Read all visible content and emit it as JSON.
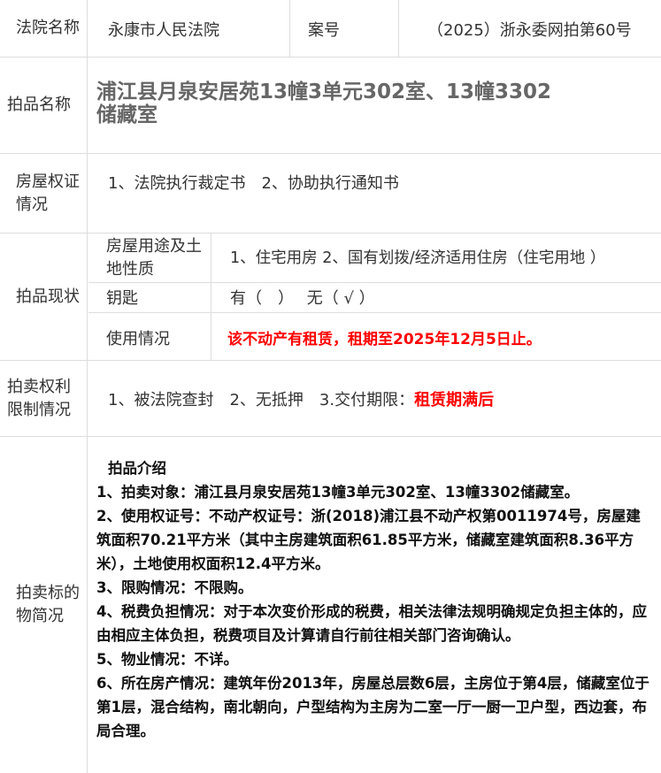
{
  "court": {
    "label": "法院名称",
    "value": "永康市人民法院",
    "case_label": "案号",
    "case_value": "（2025）浙永委网拍第60号"
  },
  "item_name": {
    "label": "拍品名称",
    "value": "浦江县月泉安居苑13幢3单元302室、13幢3302储藏室"
  },
  "certificate": {
    "label": "房屋权证情况",
    "value": "1、法院执行裁定书　2、协助执行通知书"
  },
  "status": {
    "label": "拍品现状",
    "usage_label": "房屋用途及土地性质",
    "usage_value": "1、住宅用房 2、国有划拨/经济适用住房（住宅用地 ）",
    "key_label": "钥匙",
    "key_value": "有（　）　 无（ √ ）",
    "use_label": "使用情况",
    "use_value": "该不动产有租赁，租期至2025年12月5日止。"
  },
  "restriction": {
    "label": "拍卖权利限制情况",
    "value_prefix": "1、被法院查封　2、无抵押　3.交付期限：",
    "value_highlight": "租赁期满后"
  },
  "description": {
    "label": "拍卖标的物简况",
    "heading": "拍品介绍",
    "lines": [
      "1、拍卖对象：浦江县月泉安居苑13幢3单元302室、13幢3302储藏室。",
      "2、使用权证号：不动产权证号：浙(2018)浦江县不动产权第0011974号，房屋建筑面积70.21平方米（其中主房建筑面积61.85平方米，储藏室建筑面积8.36平方米），土地使用权面积12.4平方米。",
      "3、限购情况：不限购。",
      "4、税费负担情况：对于本次变价形成的税费，相关法律法规明确规定负担主体的，应由相应主体负担，税费项目及计算请自行前往相关部门咨询确认。",
      "5、物业情况：不详。",
      "6、所在房产情况：建筑年份2013年，房屋总层数6层，主房位于第4层，储藏室位于第1层，混合结构，南北朝向，户型结构为主房为二室一厅一厨一卫户型，西边套，布局合理。"
    ]
  }
}
